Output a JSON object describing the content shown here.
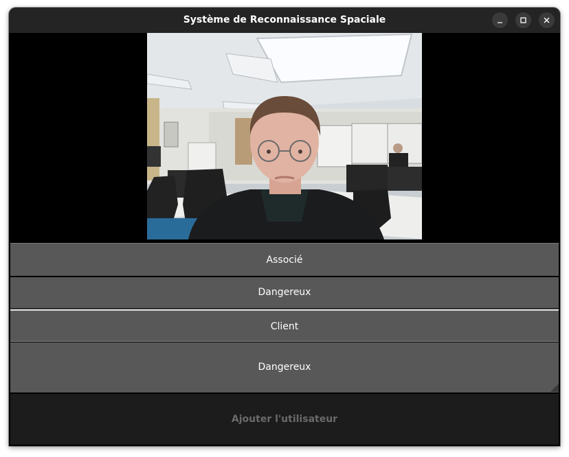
{
  "window": {
    "title": "Système de Reconnaissance Spaciale",
    "controls": [
      "minimize-icon",
      "maximize-icon",
      "close-icon"
    ]
  },
  "camera": {
    "feed_icon": "webcam-feed"
  },
  "buttons": [
    {
      "label": "Associé"
    },
    {
      "label": "Dangereux"
    },
    {
      "label": "Client"
    },
    {
      "label": "Dangereux"
    }
  ],
  "footer": {
    "add_user_label": "Ajouter l'utilisateur"
  },
  "colors": {
    "titlebar": "#242424",
    "button_bg": "#585858",
    "footer_bg": "#1c1c1c",
    "footer_text": "#6a6a6a"
  }
}
